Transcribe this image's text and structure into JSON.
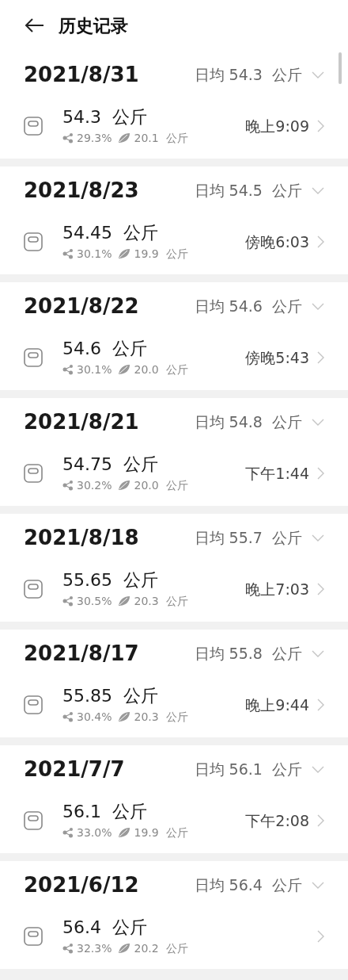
{
  "header": {
    "title": "历史记录"
  },
  "days": [
    {
      "date": "2021/8/31",
      "average": "日均 54.3  公斤",
      "records": [
        {
          "weight": "54.3  公斤",
          "fat": "29.3%",
          "muscle": "20.1  公斤",
          "time": "晚上9:09"
        }
      ]
    },
    {
      "date": "2021/8/23",
      "average": "日均 54.5  公斤",
      "records": [
        {
          "weight": "54.45  公斤",
          "fat": "30.1%",
          "muscle": "19.9  公斤",
          "time": "傍晚6:03"
        }
      ]
    },
    {
      "date": "2021/8/22",
      "average": "日均 54.6  公斤",
      "records": [
        {
          "weight": "54.6  公斤",
          "fat": "30.1%",
          "muscle": "20.0  公斤",
          "time": "傍晚5:43"
        }
      ]
    },
    {
      "date": "2021/8/21",
      "average": "日均 54.8  公斤",
      "records": [
        {
          "weight": "54.75  公斤",
          "fat": "30.2%",
          "muscle": "20.0  公斤",
          "time": "下午1:44"
        }
      ]
    },
    {
      "date": "2021/8/18",
      "average": "日均 55.7  公斤",
      "records": [
        {
          "weight": "55.65  公斤",
          "fat": "30.5%",
          "muscle": "20.3  公斤",
          "time": "晚上7:03"
        }
      ]
    },
    {
      "date": "2021/8/17",
      "average": "日均 55.8  公斤",
      "records": [
        {
          "weight": "55.85  公斤",
          "fat": "30.4%",
          "muscle": "20.3  公斤",
          "time": "晚上9:44"
        }
      ]
    },
    {
      "date": "2021/7/7",
      "average": "日均 56.1  公斤",
      "records": [
        {
          "weight": "56.1  公斤",
          "fat": "33.0%",
          "muscle": "19.9  公斤",
          "time": "下午2:08"
        }
      ]
    },
    {
      "date": "2021/6/12",
      "average": "日均 56.4  公斤",
      "records": [
        {
          "weight": "56.4  公斤",
          "fat": "32.3%",
          "muscle": "20.2  公斤"
        }
      ]
    }
  ]
}
